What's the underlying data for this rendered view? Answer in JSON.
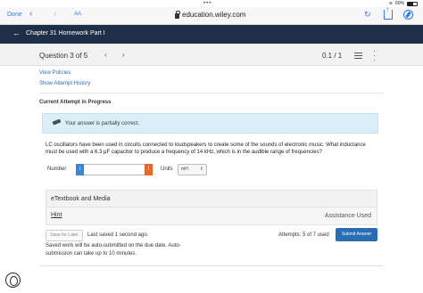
{
  "status": {
    "battery": "60%"
  },
  "browser": {
    "done_label": "Done",
    "text_size_label": "AA",
    "url": "education.wiley.com"
  },
  "header": {
    "title": "Chapter 31 Homework Part I"
  },
  "question_nav": {
    "label": "Question 3 of 5",
    "score": "0.1 / 1"
  },
  "links": {
    "view_policies": "View Policies",
    "show_attempt_history": "Show Attempt History"
  },
  "attempt_heading": "Current Attempt in Progress",
  "feedback": {
    "message": "Your answer is partially correct."
  },
  "question": {
    "text": "LC oscillators have been used in circuits connected to loudspeakers to create some of the sounds of electronic music. What inductance must be used with a 6.3 μF capacitor to produce a frequency of 14 kHz, which is in the audible range of frequencies?"
  },
  "answer": {
    "number_label": "Number",
    "info_glyph": "i",
    "warning_glyph": "!",
    "value": "",
    "units_label": "Units",
    "units_value": "mH"
  },
  "etextbook": {
    "label": "eTextbook and Media"
  },
  "hint": {
    "label": "Hint",
    "assistance": "Assistance Used"
  },
  "footer": {
    "save_for_later": "Save for Later",
    "last_saved": "Last saved 1 second ago.",
    "attempts": "Attempts: 5 of 7 used",
    "submit": "Submit Answer",
    "auto_submit_note": "Saved work will be auto-submitted on the due date. Auto-submission can take up to 10 minutes."
  }
}
